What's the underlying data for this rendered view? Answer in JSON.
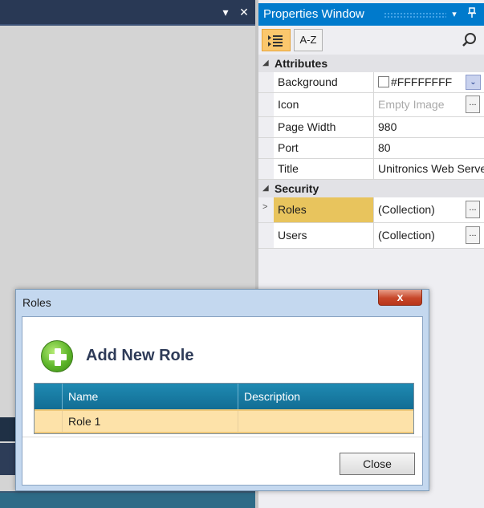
{
  "document_pane": {
    "pin_glyph": "▾",
    "close_glyph": "✕"
  },
  "properties": {
    "title": "Properties Window",
    "pin_glyph": "▾",
    "dock_glyph": "📌",
    "toolbar": {
      "categorized_icon": "categorized-icon",
      "alphabetical_label": "A-Z",
      "search_icon": "search-icon"
    },
    "categories": [
      {
        "name": "Attributes",
        "rows": [
          {
            "name": "Background",
            "value": "#FFFFFFFF"
          },
          {
            "name": "Icon",
            "value": "Empty Image"
          },
          {
            "name": "Page Width",
            "value": "980"
          },
          {
            "name": "Port",
            "value": "80"
          },
          {
            "name": "Title",
            "value": "Unitronics Web Server"
          }
        ]
      },
      {
        "name": "Security",
        "rows": [
          {
            "name": "Roles",
            "value": "(Collection)"
          },
          {
            "name": "Users",
            "value": "(Collection)"
          }
        ]
      }
    ],
    "ellipsis": "...",
    "dropdown_glyph": "⌄",
    "expand_glyph": ">"
  },
  "dialog": {
    "title": "Roles",
    "close_glyph": "x",
    "add_label": "Add New Role",
    "columns": [
      "Name",
      "Description"
    ],
    "rows": [
      {
        "name": "Role 1",
        "description": ""
      }
    ],
    "close_button": "Close"
  },
  "colors": {
    "accent": "#007acc",
    "selected_row": "#fde2a9",
    "selected_property": "#e8c45d",
    "table_header": "#126d94"
  }
}
